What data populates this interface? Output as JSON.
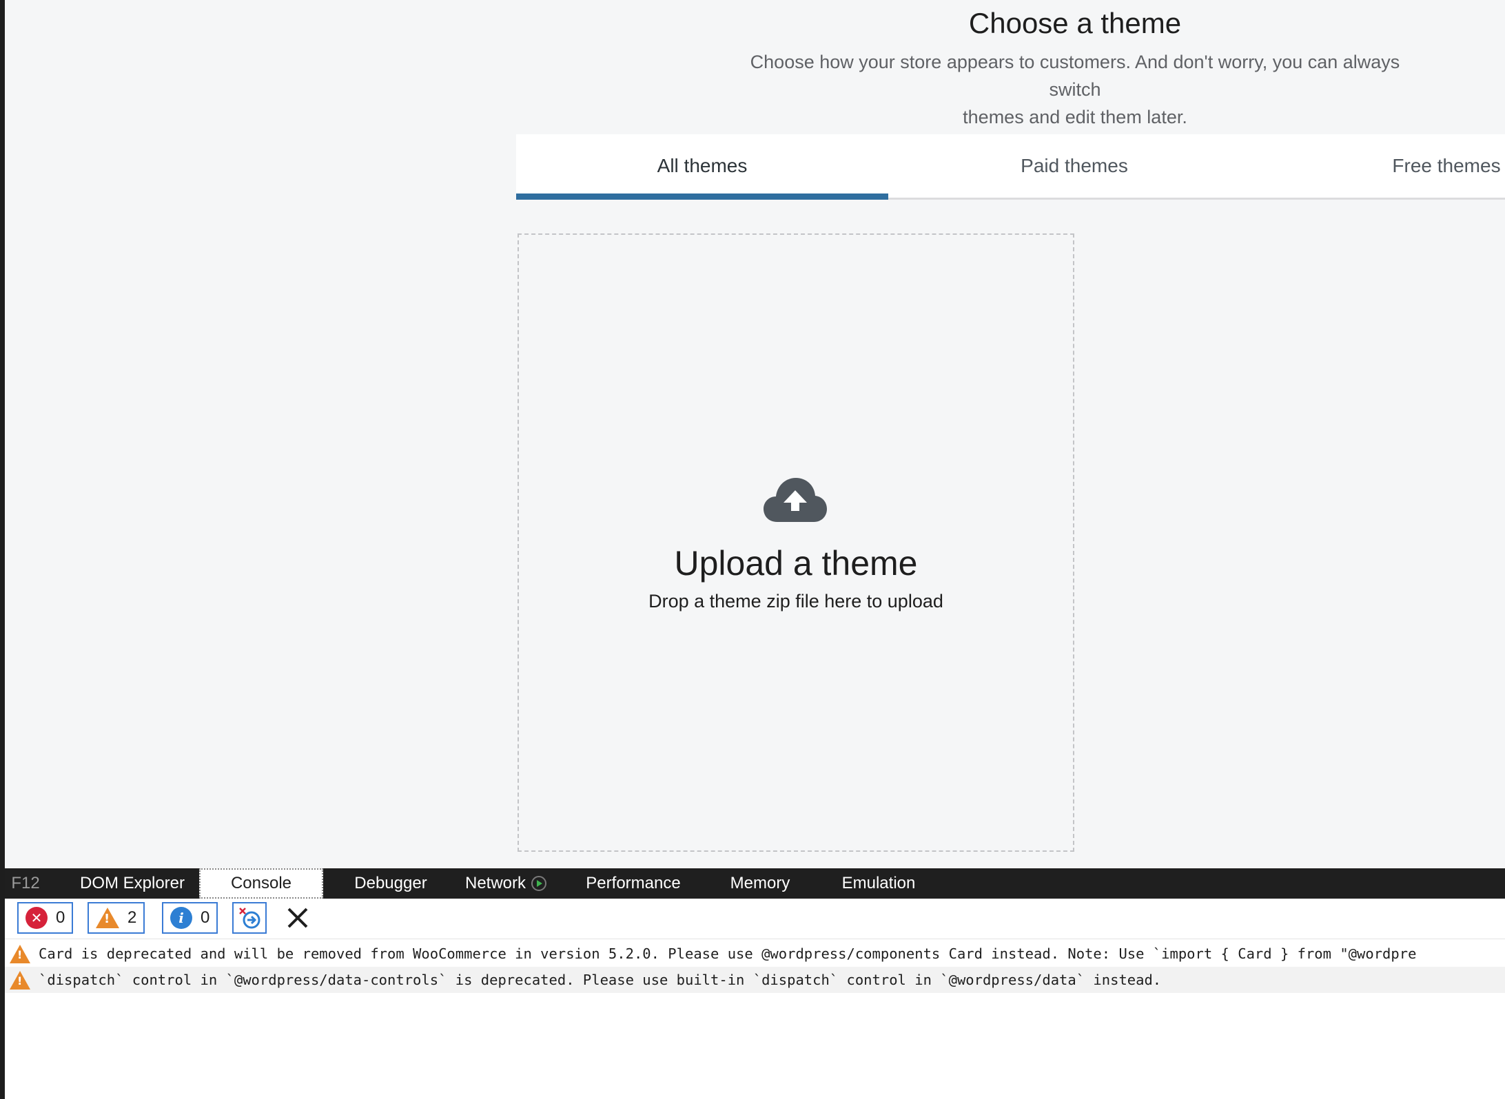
{
  "page": {
    "title": "Choose a theme",
    "subtitle_line1": "Choose how your store appears to customers. And don't worry, you can always switch",
    "subtitle_line2": "themes and edit them later."
  },
  "tabs": [
    {
      "label": "All themes",
      "active": true
    },
    {
      "label": "Paid themes",
      "active": false
    },
    {
      "label": "Free themes",
      "active": false
    }
  ],
  "upload": {
    "icon": "cloud-upload-icon",
    "title": "Upload a theme",
    "description": "Drop a theme zip file here to upload"
  },
  "devtools": {
    "tabs": [
      "F12",
      "DOM Explorer",
      "Console",
      "Debugger",
      "Network",
      "Performance",
      "Memory",
      "Emulation"
    ],
    "active_tab": "Console",
    "counters": {
      "errors": "0",
      "warnings": "2",
      "info": "0"
    },
    "messages": [
      {
        "level": "warning",
        "text": "Card is deprecated and will be removed from WooCommerce in version 5.2.0. Please use @wordpress/components Card instead. Note: Use `import { Card } from \"@wordpre"
      },
      {
        "level": "warning",
        "text": "`dispatch` control in `@wordpress/data-controls` is deprecated. Please use built-in `dispatch` control in `@wordpress/data` instead."
      }
    ]
  },
  "colors": {
    "accent": "#2f6e9f",
    "background": "#f5f6f7",
    "warning": "#e8892b",
    "error": "#d6223a",
    "info": "#2d7fd3"
  }
}
